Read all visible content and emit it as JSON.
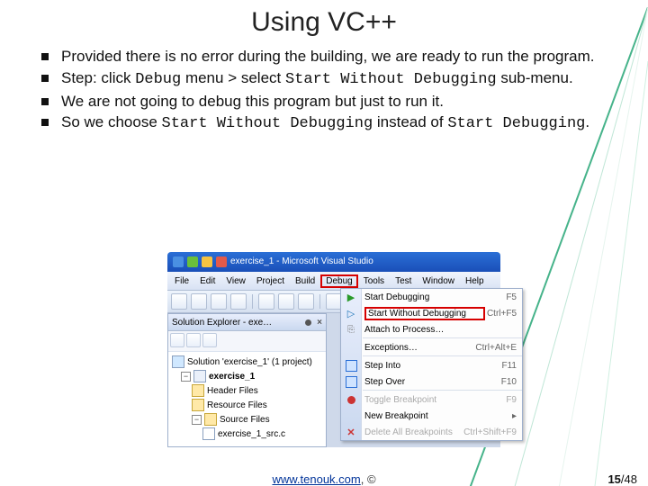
{
  "title": "Using VC++",
  "bullets": {
    "b1": "Provided there is no error during the building, we are ready to run the program.",
    "b2a": "Step: click ",
    "b2_code1": "Debug",
    "b2b": " menu > select ",
    "b2_code2": "Start Without Debugging",
    "b2c": " sub-menu.",
    "b3": "We are not going to debug this program but just to run it.",
    "b4a": "So we choose ",
    "b4_code1": "Start Without Debugging",
    "b4b": " instead of ",
    "b4_code2": "Start Debugging",
    "b4c": "."
  },
  "vs": {
    "titlebar": "exercise_1 - Microsoft Visual Studio",
    "menu": {
      "file": "File",
      "edit": "Edit",
      "view": "View",
      "project": "Project",
      "build": "Build",
      "debug": "Debug",
      "tools": "Tools",
      "test": "Test",
      "window": "Window",
      "help": "Help"
    },
    "panel_title": "Solution Explorer - exe…",
    "tree": {
      "sln": "Solution 'exercise_1' (1 project)",
      "proj": "exercise_1",
      "hdr": "Header Files",
      "res": "Resource Files",
      "src": "Source Files",
      "cfile": "exercise_1_src.c"
    },
    "dd": {
      "start_dbg": "Start Debugging",
      "start_dbg_sc": "F5",
      "start_wo": "Start Without Debugging",
      "start_wo_sc": "Ctrl+F5",
      "attach": "Attach to Process…",
      "exceptions": "Exceptions…",
      "exceptions_sc": "Ctrl+Alt+E",
      "step_into": "Step Into",
      "step_into_sc": "F11",
      "step_over": "Step Over",
      "step_over_sc": "F10",
      "toggle_bp": "Toggle Breakpoint",
      "toggle_bp_sc": "F9",
      "new_bp": "New Breakpoint",
      "del_bp": "Delete All Breakpoints",
      "del_bp_sc": "Ctrl+Shift+F9"
    }
  },
  "footer": {
    "link_text": "www.tenouk.com",
    "link_suffix": ", ©"
  },
  "page": {
    "current": "15",
    "total": "48"
  }
}
